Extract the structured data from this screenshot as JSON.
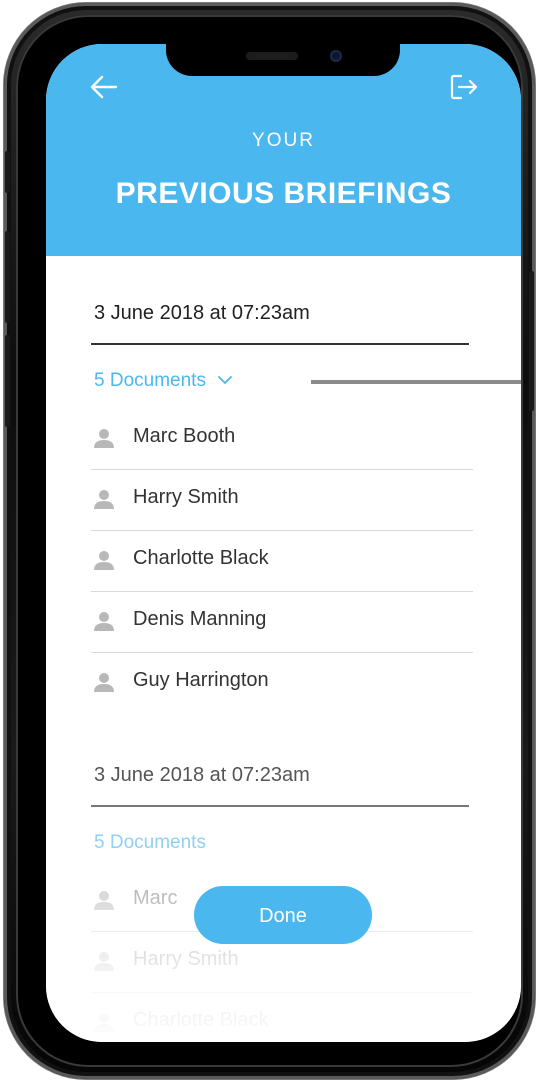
{
  "header": {
    "subtitle": "YOUR",
    "title": "PREVIOUS BRIEFINGS"
  },
  "icons": {
    "back": "arrow-left-icon",
    "logout": "logout-icon",
    "person": "person-icon",
    "chevron": "chevron-down-icon"
  },
  "colors": {
    "accent": "#4ab8ee",
    "text": "#222222",
    "muted": "#aaaaaa"
  },
  "briefings": [
    {
      "date": "3 June 2018 at 07:23am",
      "documents": "5 Documents",
      "people": [
        "Marc Booth",
        "Harry Smith",
        "Charlotte Black",
        "Denis Manning",
        "Guy Harrington"
      ]
    },
    {
      "date": "3 June 2018 at 07:23am",
      "documents": "5 Documents",
      "people": [
        "Marc",
        "Harry Smith",
        "Charlotte Black"
      ]
    }
  ],
  "done_label": "Done"
}
